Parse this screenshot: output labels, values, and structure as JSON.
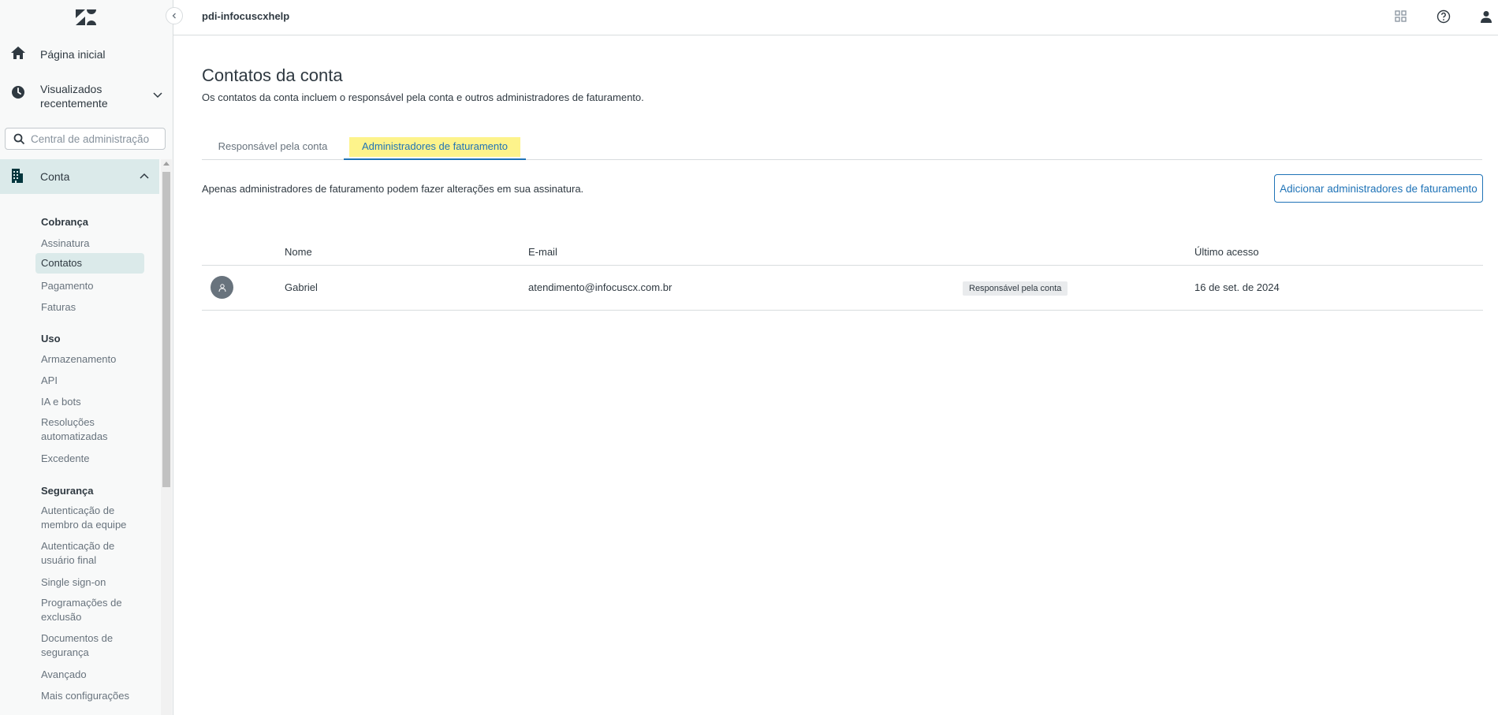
{
  "sidebar": {
    "home_label": "Página inicial",
    "recent_label": "Visualizados recentemente",
    "search_placeholder": "Central de administração",
    "account_label": "Conta",
    "sections": {
      "billing": {
        "title": "Cobrança",
        "items": [
          "Assinatura",
          "Contatos",
          "Pagamento",
          "Faturas"
        ],
        "active": "Contatos"
      },
      "usage": {
        "title": "Uso",
        "items": [
          "Armazenamento",
          "API",
          "IA e bots",
          "Resoluções automatizadas",
          "Excedente"
        ]
      },
      "security": {
        "title": "Segurança",
        "items": [
          "Autenticação de membro da equipe",
          "Autenticação de usuário final",
          "Single sign-on",
          "Programações de exclusão",
          "Documentos de segurança",
          "Avançado",
          "Mais configurações"
        ]
      }
    }
  },
  "header": {
    "title": "pdi-infocuscxhelp",
    "icons": [
      "products-grid-icon",
      "help-icon",
      "user-icon"
    ]
  },
  "main": {
    "title": "Contatos da conta",
    "description": "Os contatos da conta incluem o responsável pela conta e outros administradores de faturamento.",
    "tabs": [
      {
        "label": "Responsável pela conta",
        "selected": false
      },
      {
        "label": "Administradores de faturamento",
        "selected": true
      }
    ],
    "info": "Apenas administradores de faturamento podem fazer alterações em sua assinatura.",
    "add_button": "Adicionar administradores de faturamento",
    "table": {
      "columns": [
        "Nome",
        "E-mail",
        "Último acesso"
      ],
      "rows": [
        {
          "name": "Gabriel",
          "email": "atendimento@infocuscx.com.br",
          "badge": "Responsável pela conta",
          "last_access": "16 de set. de 2024"
        }
      ]
    }
  },
  "colors": {
    "accent": "#1f73b7",
    "sidebar_active": "#dbeaea",
    "tab_highlight": "#fdf38b",
    "text": "#2f3941",
    "muted": "#68737d"
  }
}
